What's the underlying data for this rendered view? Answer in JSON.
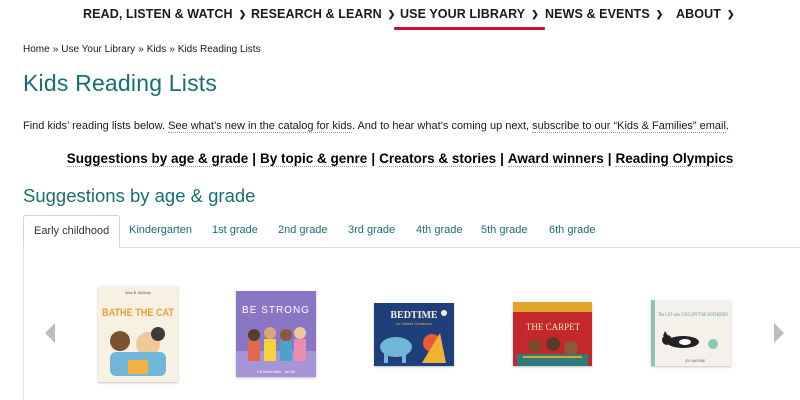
{
  "nav": {
    "items": [
      {
        "label": "READ, LISTEN & WATCH",
        "active": false
      },
      {
        "label": "RESEARCH & LEARN",
        "active": false
      },
      {
        "label": "USE YOUR LIBRARY",
        "active": true
      },
      {
        "label": "NEWS & EVENTS",
        "active": false
      },
      {
        "label": "ABOUT",
        "active": false
      }
    ]
  },
  "breadcrumb": {
    "home": "Home",
    "use_your_library": "Use Your Library",
    "kids": "Kids",
    "current": "Kids Reading Lists",
    "separator": "»"
  },
  "page_title": "Kids Reading Lists",
  "intro": {
    "text1": "Find kids’ reading lists below. ",
    "link1": "See what’s new in the catalog for kids",
    "text2": ". And to hear what’s coming up next, ",
    "link2": "subscribe to our “Kids & Families” email",
    "text3": "."
  },
  "jump_links": {
    "age_grade": "Suggestions by age & grade",
    "topic_genre": "By topic & genre",
    "creators": "Creators & stories",
    "awards": "Award winners",
    "olympics": "Reading Olympics",
    "pipe": "|"
  },
  "section_title": "Suggestions by age & grade",
  "tabs": [
    {
      "label": "Early childhood",
      "active": true
    },
    {
      "label": "Kindergarten",
      "active": false
    },
    {
      "label": "1st grade",
      "active": false
    },
    {
      "label": "2nd grade",
      "active": false
    },
    {
      "label": "3rd grade",
      "active": false
    },
    {
      "label": "4th grade",
      "active": false
    },
    {
      "label": "5th grade",
      "active": false
    },
    {
      "label": "6th grade",
      "active": false
    }
  ],
  "books": [
    {
      "cover_title": "BATHE THE CAT",
      "cover_credit": "Alice B. McGinty",
      "colors": [
        "#f7f1e4",
        "#e8a23b"
      ]
    },
    {
      "cover_title": "BE STRONG",
      "cover_credit": "Pat Zietlow Miller · Jen Hill",
      "colors": [
        "#8a76c4",
        "#5d4aa0"
      ]
    },
    {
      "cover_title": "BEDTIME",
      "cover_subtitle": "for Sweet Creatures",
      "colors": [
        "#1f3f7a",
        "#f2b233"
      ]
    },
    {
      "cover_title": "THE CARPET",
      "colors": [
        "#c5282c",
        "#e0a62a"
      ]
    },
    {
      "cover_title": "The CAT who COULDN'T BE BOTHERED",
      "cover_credit": "JOY McCRAE",
      "colors": [
        "#f3f1ea",
        "#8cc7ad"
      ]
    }
  ],
  "carousel": {
    "prev_icon": "chevron-left-icon",
    "next_icon": "chevron-right-icon"
  },
  "colors": {
    "accent": "#1a6e72",
    "active_underline": "#c8102e"
  }
}
